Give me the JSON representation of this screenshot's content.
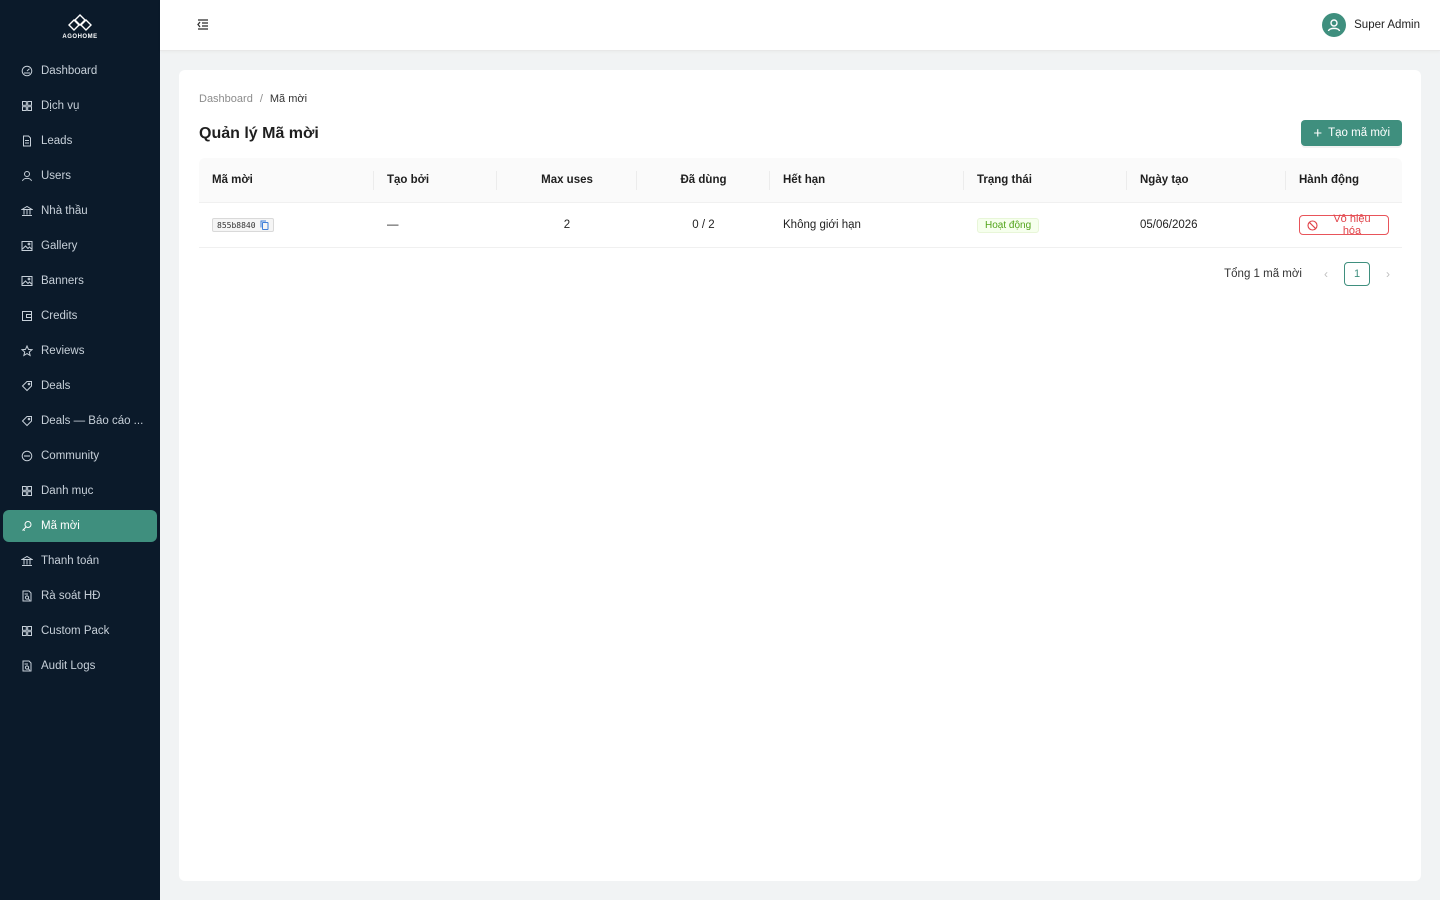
{
  "brand": {
    "name": "AGOHOME"
  },
  "sidebar": {
    "items": [
      {
        "label": "Dashboard",
        "icon": "dashboard-icon"
      },
      {
        "label": "Dịch vụ",
        "icon": "grid-icon"
      },
      {
        "label": "Leads",
        "icon": "document-icon"
      },
      {
        "label": "Users",
        "icon": "user-icon"
      },
      {
        "label": "Nhà thầu",
        "icon": "bank-icon"
      },
      {
        "label": "Gallery",
        "icon": "image-icon"
      },
      {
        "label": "Banners",
        "icon": "image-icon"
      },
      {
        "label": "Credits",
        "icon": "wallet-icon"
      },
      {
        "label": "Reviews",
        "icon": "star-icon"
      },
      {
        "label": "Deals",
        "icon": "tag-icon"
      },
      {
        "label": "Deals — Báo cáo ...",
        "icon": "tag-icon"
      },
      {
        "label": "Community",
        "icon": "message-icon"
      },
      {
        "label": "Danh mục",
        "icon": "grid-icon"
      },
      {
        "label": "Mã mời",
        "icon": "key-icon",
        "active": true
      },
      {
        "label": "Thanh toán",
        "icon": "bank-icon"
      },
      {
        "label": "Rà soát HĐ",
        "icon": "audit-icon"
      },
      {
        "label": "Custom Pack",
        "icon": "grid-icon"
      },
      {
        "label": "Audit Logs",
        "icon": "audit-icon"
      }
    ]
  },
  "header": {
    "user_name": "Super Admin"
  },
  "breadcrumb": {
    "root": "Dashboard",
    "separator": "/",
    "current": "Mã mời"
  },
  "page": {
    "title": "Quản lý Mã mời",
    "create_label": "Tạo mã mời"
  },
  "table": {
    "columns": [
      "Mã mời",
      "Tạo bởi",
      "Max uses",
      "Đã dùng",
      "Hết hạn",
      "Trạng thái",
      "Ngày tạo",
      "Hành động"
    ],
    "rows": [
      {
        "code": "855b8840",
        "created_by": "—",
        "max_uses": "2",
        "used": "0 / 2",
        "expires": "Không giới hạn",
        "status": "Hoạt động",
        "created_at": "05/06/2026",
        "action": "Vô hiệu hóa"
      }
    ]
  },
  "pagination": {
    "total": "Tổng 1 mã mời",
    "current_page": "1",
    "prev": "‹",
    "next": "›"
  },
  "colors": {
    "sidebar_bg": "#0b1a2a",
    "accent": "#3f8f7e",
    "danger": "#e04248",
    "success": "#52a41a"
  }
}
